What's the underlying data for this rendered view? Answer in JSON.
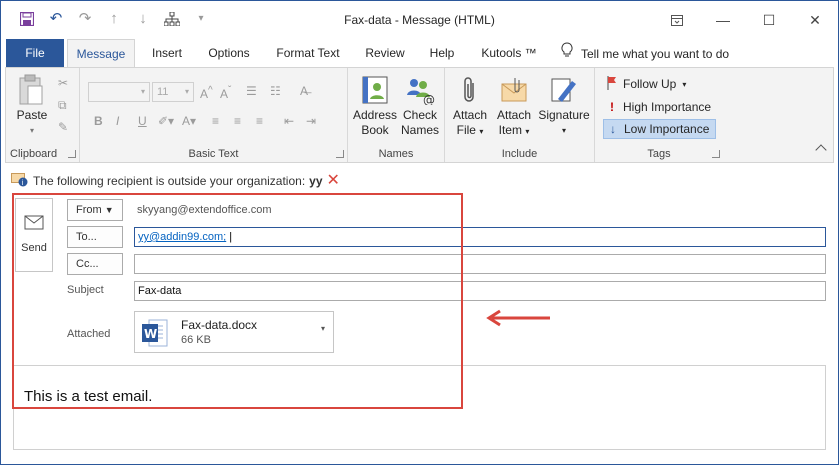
{
  "titlebar": {
    "title": "Fax-data  -  Message (HTML)",
    "qat_icons": [
      "save-icon",
      "undo-icon",
      "redo-icon",
      "up-arrow-icon",
      "down-arrow-icon",
      "hierarchy-icon",
      "customize-icon"
    ]
  },
  "tabs": {
    "file": "File",
    "items": [
      "Message",
      "Insert",
      "Options",
      "Format Text",
      "Review",
      "Help",
      "Kutools ™"
    ],
    "active": "Message",
    "tell_me": "Tell me what you want to do"
  },
  "ribbon": {
    "clipboard": {
      "label": "Clipboard",
      "paste": "Paste"
    },
    "basic_text": {
      "label": "Basic Text",
      "font_size": "11"
    },
    "names": {
      "label": "Names",
      "address_book": [
        "Address",
        "Book"
      ],
      "check_names": [
        "Check",
        "Names"
      ]
    },
    "include": {
      "label": "Include",
      "attach_file": [
        "Attach",
        "File"
      ],
      "attach_item": [
        "Attach",
        "Item"
      ],
      "signature": "Signature"
    },
    "tags": {
      "label": "Tags",
      "follow_up": "Follow Up",
      "high": "High Importance",
      "low": "Low Importance"
    }
  },
  "infobar": {
    "text": "The following recipient is outside your organization:",
    "recipient": "yy"
  },
  "compose": {
    "send": "Send",
    "from_label": "From",
    "from_value": "skyyang@extendoffice.com",
    "to_label": "To...",
    "to_value": "yy@addin99.com;",
    "cc_label": "Cc...",
    "cc_value": "",
    "subject_label": "Subject",
    "subject_value": "Fax-data",
    "attached_label": "Attached",
    "attachment": {
      "name": "Fax-data.docx",
      "size": "66 KB"
    },
    "body": "This is a test email."
  },
  "colors": {
    "accent": "#2b579a",
    "highlight": "#d9463d",
    "selected": "#c5d9f1"
  }
}
